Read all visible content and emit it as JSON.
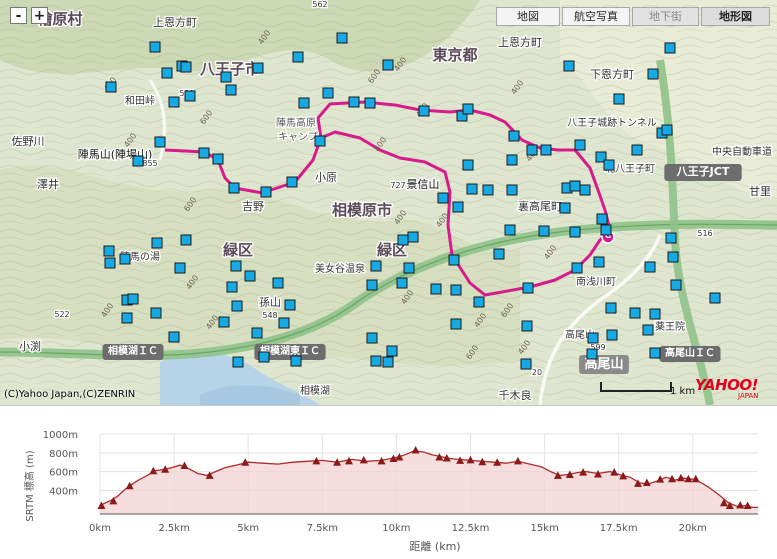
{
  "map": {
    "zoom_in_label": "+",
    "zoom_out_label": "-",
    "map_types": [
      {
        "label": "地図",
        "state": "normal"
      },
      {
        "label": "航空写真",
        "state": "normal"
      },
      {
        "label": "地下街",
        "state": "disabled"
      },
      {
        "label": "地形図",
        "state": "active"
      }
    ],
    "copyright": "(C)Yahoo Japan,(C)ZENRIN",
    "scale_label": "1 km",
    "logo_text": "YAHOO!",
    "logo_subtext": "JAPAN",
    "place_labels": [
      {
        "text": "檜原村",
        "size": 15,
        "weight": "bold",
        "color": "#5a4a5a"
      },
      {
        "text": "上恩方町",
        "size": 11,
        "weight": "normal",
        "color": "#333333"
      },
      {
        "text": "八王子市",
        "size": 15,
        "weight": "bold",
        "color": "#5a4a5a"
      },
      {
        "text": "和田峠",
        "size": 10,
        "weight": "normal",
        "color": "#333333"
      },
      {
        "text": "佐野川",
        "size": 11,
        "weight": "normal",
        "color": "#333333"
      },
      {
        "text": "陣馬山(陣場山)",
        "size": 11,
        "weight": "normal",
        "color": "#111111"
      },
      {
        "text": "855",
        "size": 8,
        "weight": "normal",
        "color": "#333333"
      },
      {
        "text": "澤井",
        "size": 11,
        "weight": "normal",
        "color": "#333333"
      },
      {
        "text": "陣馬高原",
        "size": 10,
        "weight": "normal",
        "color": "#555555"
      },
      {
        "text": "キャンプ",
        "size": 10,
        "weight": "normal",
        "color": "#555555"
      },
      {
        "text": "小原",
        "size": 11,
        "weight": "normal",
        "color": "#333333"
      },
      {
        "text": "吉野",
        "size": 11,
        "weight": "normal",
        "color": "#333333"
      },
      {
        "text": "相模原市",
        "size": 15,
        "weight": "bold",
        "color": "#5a4a5a"
      },
      {
        "text": "緑区",
        "size": 15,
        "weight": "bold",
        "color": "#5a4a5a"
      },
      {
        "text": "緑区",
        "size": 15,
        "weight": "bold",
        "color": "#5a4a5a"
      },
      {
        "text": "727",
        "size": 8,
        "weight": "normal",
        "color": "#333333"
      },
      {
        "text": "景信山",
        "size": 11,
        "weight": "normal",
        "color": "#111111"
      },
      {
        "text": "東京都",
        "size": 15,
        "weight": "bold",
        "color": "#5a4a5a"
      },
      {
        "text": "上恩方町",
        "size": 11,
        "weight": "normal",
        "color": "#333333"
      },
      {
        "text": "下恩方町",
        "size": 11,
        "weight": "normal",
        "color": "#333333"
      },
      {
        "text": "八王子城跡トンネル",
        "size": 10,
        "weight": "normal",
        "color": "#333333"
      },
      {
        "text": "北八王子町",
        "size": 10,
        "weight": "normal",
        "color": "#333333"
      },
      {
        "text": "裏高尾町",
        "size": 11,
        "weight": "normal",
        "color": "#333333"
      },
      {
        "text": "八王子JCT",
        "size": 11,
        "weight": "bold",
        "color": "#ffffff"
      },
      {
        "text": "中央自動車道",
        "size": 10,
        "weight": "normal",
        "color": "#333333"
      },
      {
        "text": "甘里",
        "size": 11,
        "weight": "normal",
        "color": "#333333"
      },
      {
        "text": "南浅川町",
        "size": 10,
        "weight": "normal",
        "color": "#333333"
      },
      {
        "text": "陣馬の湯",
        "size": 10,
        "weight": "normal",
        "color": "#333333"
      },
      {
        "text": "美女谷温泉",
        "size": 10,
        "weight": "normal",
        "color": "#333333"
      },
      {
        "text": "孫山",
        "size": 11,
        "weight": "normal",
        "color": "#333333"
      },
      {
        "text": "548",
        "size": 8,
        "weight": "normal",
        "color": "#333333"
      },
      {
        "text": "小渕",
        "size": 11,
        "weight": "normal",
        "color": "#333333"
      },
      {
        "text": "相模湖ＩＣ",
        "size": 10,
        "weight": "bold",
        "color": "#ffffff"
      },
      {
        "text": "相模湖東ＩＣ",
        "size": 10,
        "weight": "bold",
        "color": "#ffffff"
      },
      {
        "text": "高尾山ＩＣ",
        "size": 10,
        "weight": "bold",
        "color": "#ffffff"
      },
      {
        "text": "高尾山",
        "size": 13,
        "weight": "bold",
        "color": "#ffffff"
      },
      {
        "text": "高尾山",
        "size": 10,
        "weight": "normal",
        "color": "#333333"
      },
      {
        "text": "599",
        "size": 8,
        "weight": "normal",
        "color": "#333333"
      },
      {
        "text": "薬王院",
        "size": 10,
        "weight": "normal",
        "color": "#333333"
      },
      {
        "text": "相模湖",
        "size": 10,
        "weight": "normal",
        "color": "#333333"
      },
      {
        "text": "千木良",
        "size": 11,
        "weight": "normal",
        "color": "#333333"
      },
      {
        "text": "562",
        "size": 8,
        "weight": "normal",
        "color": "#333333"
      },
      {
        "text": "521",
        "size": 8,
        "weight": "normal",
        "color": "#333333"
      },
      {
        "text": "522",
        "size": 8,
        "weight": "normal",
        "color": "#333333"
      },
      {
        "text": "516",
        "size": 8,
        "weight": "normal",
        "color": "#333333"
      },
      {
        "text": "20",
        "size": 8,
        "weight": "normal",
        "color": "#333333"
      },
      {
        "text": "G",
        "size": 8,
        "weight": "bold",
        "color": "#ffffff"
      }
    ],
    "contour_labels": [
      "600",
      "400",
      "600",
      "800",
      "600",
      "400",
      "400",
      "400",
      "400",
      "400",
      "400",
      "600",
      "400",
      "400",
      "600",
      "400",
      "400",
      "400",
      "400",
      "400",
      "400",
      "400"
    ]
  },
  "chart_data": {
    "type": "area",
    "title": "",
    "xlabel": "距離 (km)",
    "ylabel": "SRTM 標高 (m)",
    "xlim": [
      0,
      22.2
    ],
    "ylim": [
      150,
      1000
    ],
    "x_ticks": [
      0,
      2.5,
      5,
      7.5,
      10,
      12.5,
      15,
      17.5,
      20
    ],
    "x_tick_labels": [
      "0km",
      "2.5km",
      "5km",
      "7.5km",
      "10km",
      "12.5km",
      "15km",
      "17.5km",
      "20km"
    ],
    "y_ticks": [
      400,
      600,
      800,
      1000
    ],
    "y_tick_labels": [
      "400m",
      "600m",
      "800m",
      "1000m"
    ],
    "grid": true,
    "profile": {
      "x": [
        0.0,
        0.2,
        0.4,
        0.6,
        0.8,
        1.0,
        1.3,
        1.6,
        1.85,
        2.1,
        2.4,
        2.7,
        3.0,
        3.3,
        3.6,
        3.9,
        4.2,
        4.6,
        5.0,
        5.5,
        6.0,
        6.5,
        7.0,
        7.5,
        8.0,
        8.5,
        9.0,
        9.5,
        10.0,
        10.3,
        10.6,
        10.9,
        11.2,
        11.5,
        11.8,
        12.1,
        12.5,
        12.9,
        13.3,
        13.7,
        14.1,
        14.5,
        14.9,
        15.2,
        15.5,
        15.8,
        16.1,
        16.4,
        16.8,
        17.2,
        17.6,
        17.9,
        18.2,
        18.5,
        18.8,
        19.1,
        19.4,
        19.7,
        20.0,
        20.3,
        20.6,
        20.9,
        21.2,
        21.5,
        21.8,
        22.0,
        22.2
      ],
      "y": [
        240,
        270,
        300,
        340,
        400,
        450,
        510,
        560,
        610,
        620,
        640,
        670,
        630,
        580,
        560,
        600,
        640,
        670,
        700,
        690,
        680,
        700,
        710,
        720,
        700,
        730,
        710,
        720,
        750,
        780,
        820,
        810,
        780,
        760,
        740,
        730,
        720,
        710,
        700,
        690,
        710,
        680,
        650,
        600,
        560,
        570,
        590,
        600,
        580,
        600,
        560,
        540,
        480,
        470,
        500,
        540,
        510,
        530,
        520,
        480,
        420,
        350,
        270,
        230,
        240,
        220,
        220
      ]
    },
    "markers": [
      {
        "x": 0.05,
        "y": 240
      },
      {
        "x": 0.45,
        "y": 290
      },
      {
        "x": 1.0,
        "y": 450
      },
      {
        "x": 1.8,
        "y": 610
      },
      {
        "x": 2.2,
        "y": 625
      },
      {
        "x": 2.85,
        "y": 665
      },
      {
        "x": 3.7,
        "y": 560
      },
      {
        "x": 4.9,
        "y": 700
      },
      {
        "x": 7.3,
        "y": 715
      },
      {
        "x": 8.0,
        "y": 700
      },
      {
        "x": 8.4,
        "y": 715
      },
      {
        "x": 8.9,
        "y": 725
      },
      {
        "x": 9.5,
        "y": 715
      },
      {
        "x": 9.9,
        "y": 740
      },
      {
        "x": 10.1,
        "y": 755
      },
      {
        "x": 10.65,
        "y": 830
      },
      {
        "x": 11.45,
        "y": 755
      },
      {
        "x": 11.7,
        "y": 745
      },
      {
        "x": 12.15,
        "y": 720
      },
      {
        "x": 12.5,
        "y": 725
      },
      {
        "x": 12.9,
        "y": 705
      },
      {
        "x": 13.4,
        "y": 700
      },
      {
        "x": 14.1,
        "y": 715
      },
      {
        "x": 15.45,
        "y": 560
      },
      {
        "x": 15.85,
        "y": 570
      },
      {
        "x": 16.3,
        "y": 595
      },
      {
        "x": 16.8,
        "y": 575
      },
      {
        "x": 17.35,
        "y": 595
      },
      {
        "x": 17.65,
        "y": 555
      },
      {
        "x": 18.15,
        "y": 475
      },
      {
        "x": 18.45,
        "y": 485
      },
      {
        "x": 18.9,
        "y": 520
      },
      {
        "x": 19.3,
        "y": 525
      },
      {
        "x": 19.6,
        "y": 535
      },
      {
        "x": 19.85,
        "y": 525
      },
      {
        "x": 20.1,
        "y": 525
      },
      {
        "x": 21.05,
        "y": 270
      },
      {
        "x": 21.25,
        "y": 240
      },
      {
        "x": 21.6,
        "y": 245
      },
      {
        "x": 21.85,
        "y": 240
      }
    ],
    "colors": {
      "line": "#b12a2a",
      "fill": "#f3d0d0",
      "marker": "#8b1a1a",
      "grid": "#e3e3e3",
      "axis": "#555555"
    }
  }
}
